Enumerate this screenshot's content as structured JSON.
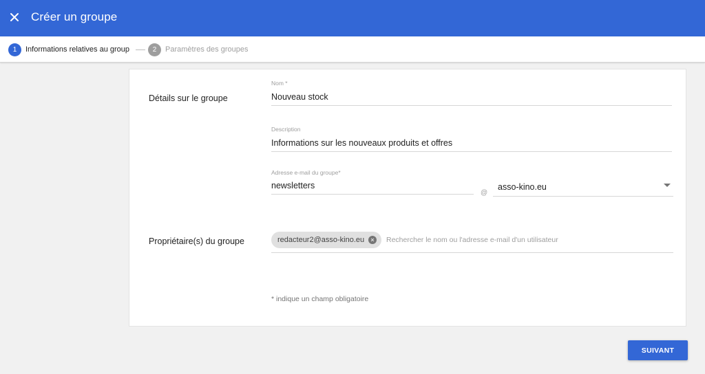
{
  "header": {
    "close_icon": "close-icon",
    "title": "Créer un groupe"
  },
  "stepper": {
    "steps": [
      {
        "number": "1",
        "label": "Informations relatives au group",
        "active": true
      },
      {
        "number": "2",
        "label": "Paramètres des groupes",
        "active": false
      }
    ]
  },
  "details": {
    "section_label": "Détails sur le groupe",
    "name": {
      "label": "Nom *",
      "value": "Nouveau stock"
    },
    "description": {
      "label": "Description",
      "value": "Informations sur les nouveaux produits et offres"
    },
    "email": {
      "label": "Adresse e-mail du groupe*",
      "value": "newsletters",
      "at": "@",
      "domain": "asso-kino.eu"
    }
  },
  "owners": {
    "section_label": "Propriétaire(s) du groupe",
    "chip": "redacteur2@asso-kino.eu",
    "chip_remove": "×",
    "search_placeholder": "Rechercher le nom ou l'adresse e-mail d'un utilisateur"
  },
  "footnote": "* indique un champ obligatoire",
  "actions": {
    "next_label": "SUIVANT"
  },
  "colors": {
    "accent": "#3367d6",
    "background": "#f1f1f1"
  }
}
